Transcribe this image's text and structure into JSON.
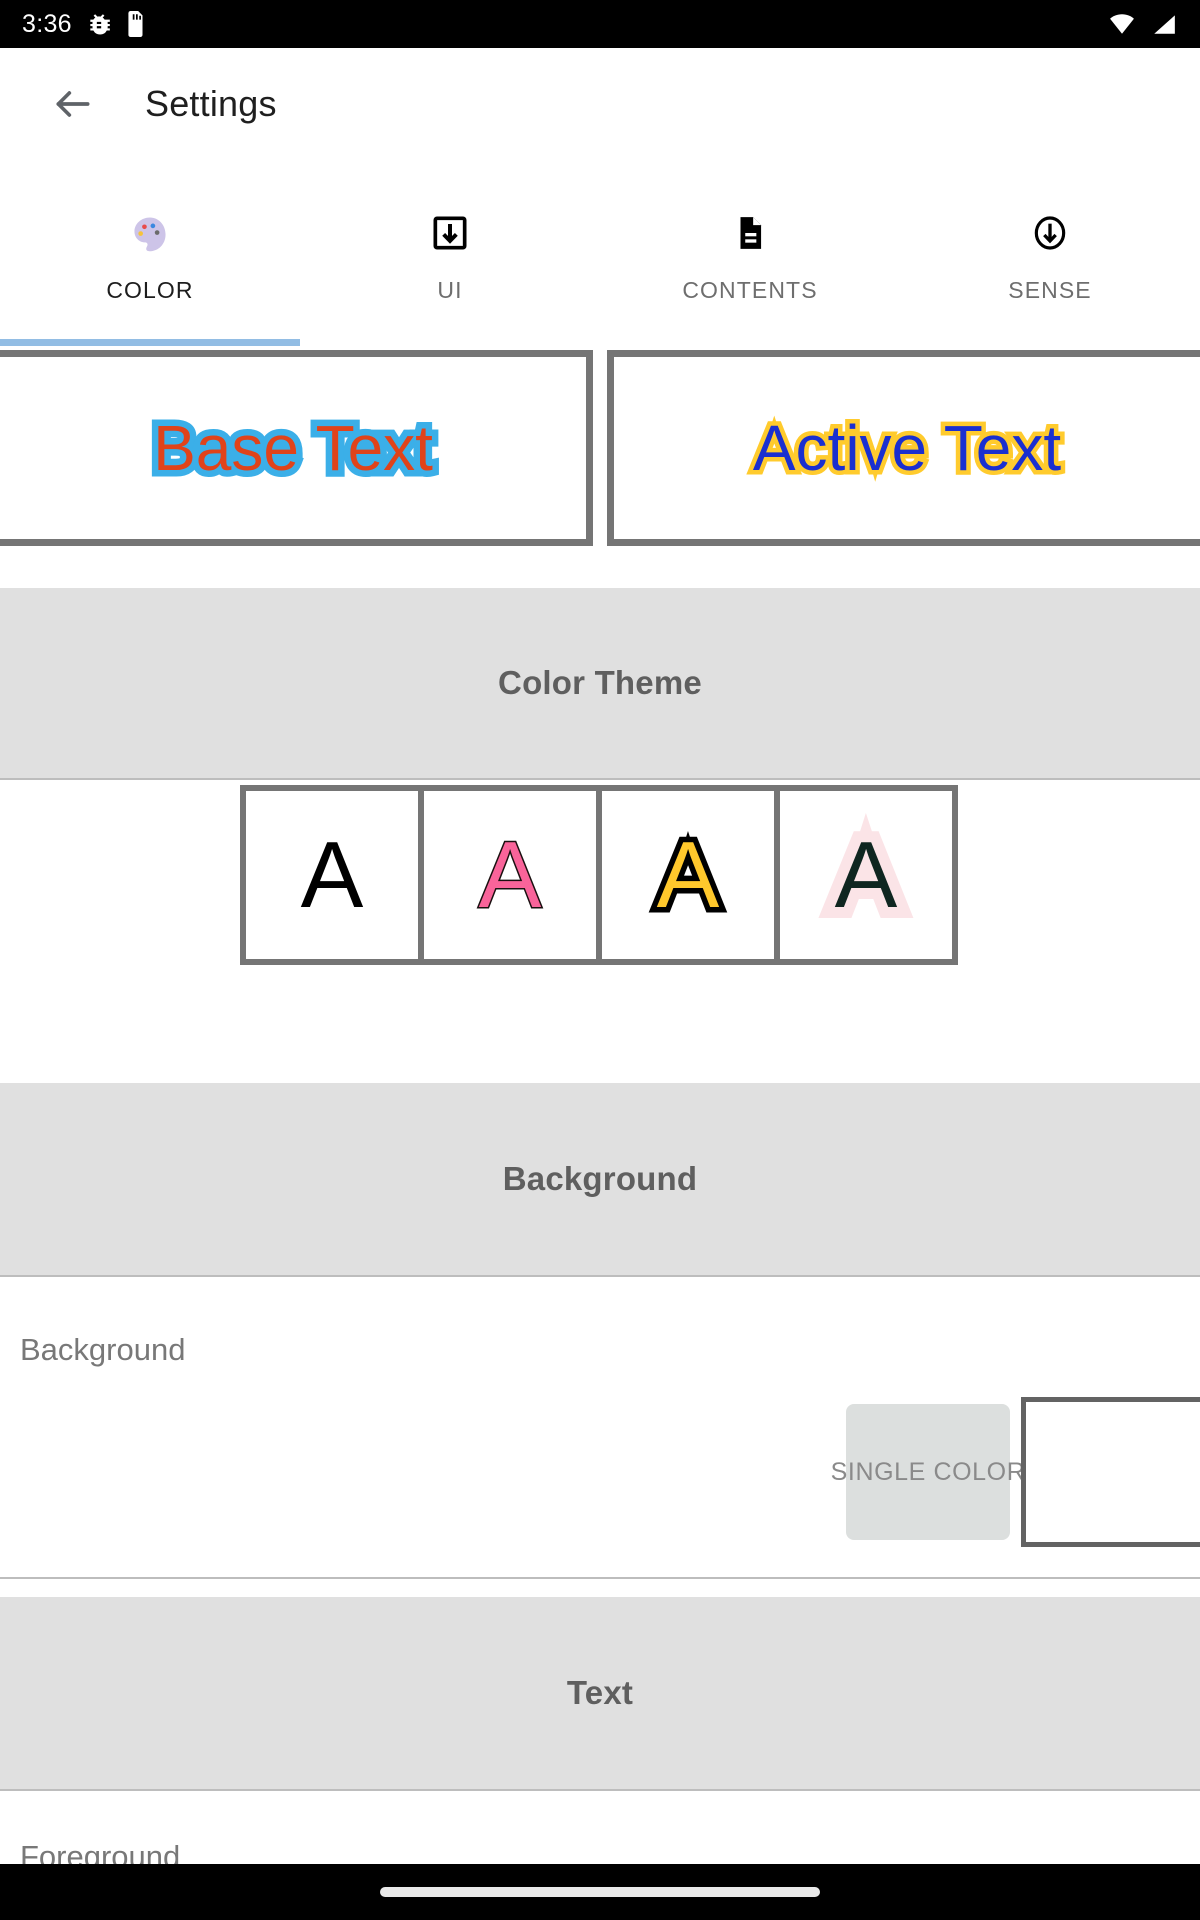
{
  "status_bar": {
    "time": "3:36",
    "left_icons": [
      "bug-icon",
      "sd-card-icon"
    ],
    "right_icons": [
      "wifi-icon",
      "cell-signal-icon"
    ],
    "background": "#000000"
  },
  "app_bar": {
    "back_icon": "back-arrow-icon",
    "title": "Settings"
  },
  "tabs": {
    "active_index": 0,
    "indicator_color": "#92bde4",
    "items": [
      {
        "label": "COLOR",
        "icon": "palette-icon",
        "glyph": "🎨"
      },
      {
        "label": "UI",
        "icon": "download-box-icon",
        "glyph": ""
      },
      {
        "label": "CONTENTS",
        "icon": "document-icon",
        "glyph": ""
      },
      {
        "label": "SENSE",
        "icon": "circle-down-arrow-icon",
        "glyph": ""
      }
    ]
  },
  "preview": {
    "base": {
      "text": "Base Text",
      "fill_color": "#e0431a",
      "outline_color": "#3bafe8"
    },
    "active": {
      "text": "Active Text",
      "fill_color": "#1a2fd0",
      "outline_color": "#ffcb2d"
    }
  },
  "sections": {
    "color_theme": {
      "header": "Color Theme",
      "swatches": [
        {
          "letter": "A",
          "fill_color": "#000000",
          "outline_color": "none"
        },
        {
          "letter": "A",
          "fill_color": "#f9649a",
          "outline_color": "#1a1010"
        },
        {
          "letter": "A",
          "fill_color": "#ffc82c",
          "outline_color": "#000000"
        },
        {
          "letter": "A",
          "fill_color": "#0f2620",
          "outline_color": "#fbe4e7"
        }
      ]
    },
    "background": {
      "header": "Background",
      "row_title": "Background",
      "mode_button": "SINGLE COLOR",
      "swatch_color": "#ffffff"
    },
    "text": {
      "header": "Text",
      "row_title": "Foreground"
    }
  },
  "nav_bar": {
    "gesture_pill": "home-gesture-pill"
  }
}
